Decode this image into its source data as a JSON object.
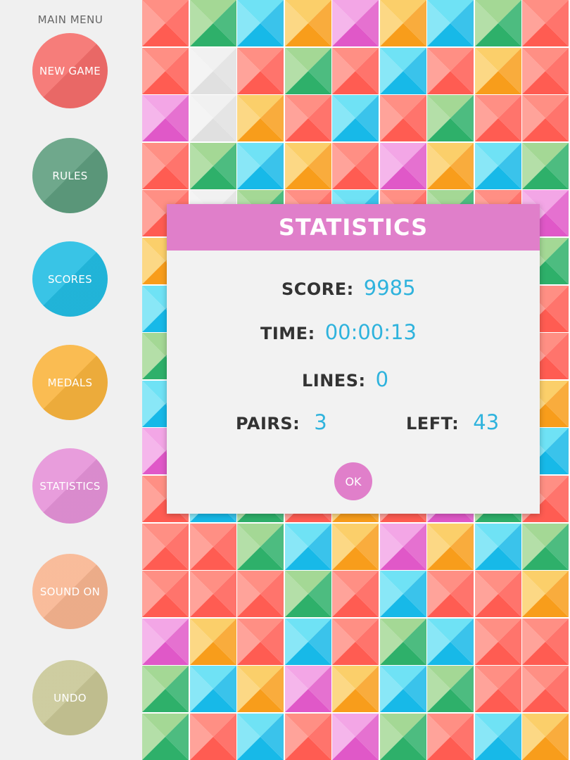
{
  "sidebar": {
    "title": "MAIN MENU",
    "buttons": [
      {
        "label": "NEW GAME",
        "color": "#f56e6b"
      },
      {
        "label": "RULES",
        "color": "#5f9e7f"
      },
      {
        "label": "SCORES",
        "color": "#23bde3"
      },
      {
        "label": "MEDALS",
        "color": "#f9b43e"
      },
      {
        "label": "STATISTICS",
        "color": "#e592d8"
      },
      {
        "label": "SOUND ON",
        "color": "#f8b590"
      },
      {
        "label": "UNDO",
        "color": "#c9c796"
      }
    ]
  },
  "board": {
    "columns": 9,
    "rows": 16,
    "palette": {
      "R": [
        "#ff8f84",
        "#ff5c52"
      ],
      "G": [
        "#a4d895",
        "#2eb06a"
      ],
      "B": [
        "#6fe2f5",
        "#17b9e8"
      ],
      "O": [
        "#fbcf6a",
        "#f89d1b"
      ],
      "P": [
        "#f3a6e6",
        "#e058c8"
      ],
      "W": [
        "#f1f1f1",
        "#e0e0e0"
      ]
    },
    "grid": [
      "RGBOPOBGR",
      "RWRGRBROR",
      "PWORBRGRR",
      "RGBORPOBG",
      "RWGRBRGRP",
      "OPRGBOGRG",
      "BRGOBRPOR",
      "GORBRGRBR",
      "BRPGORBRO",
      "PGORBRGOB",
      "RBGRORPGR",
      "RRGBOPOBG",
      "RRRGRBRRO",
      "PORBRGBRR",
      "GBOPOBGRR",
      "GRBRPGRBO"
    ]
  },
  "dialog": {
    "title": "STATISTICS",
    "score_label": "SCORE:",
    "score_value": "9985",
    "time_label": "TIME:",
    "time_value": "00:00:13",
    "lines_label": "LINES:",
    "lines_value": "0",
    "pairs_label": "PAIRS:",
    "pairs_value": "3",
    "left_label": "LEFT:",
    "left_value": "43",
    "ok_label": "OK",
    "header_color": "#e07fca",
    "value_color": "#2fb3dd"
  }
}
